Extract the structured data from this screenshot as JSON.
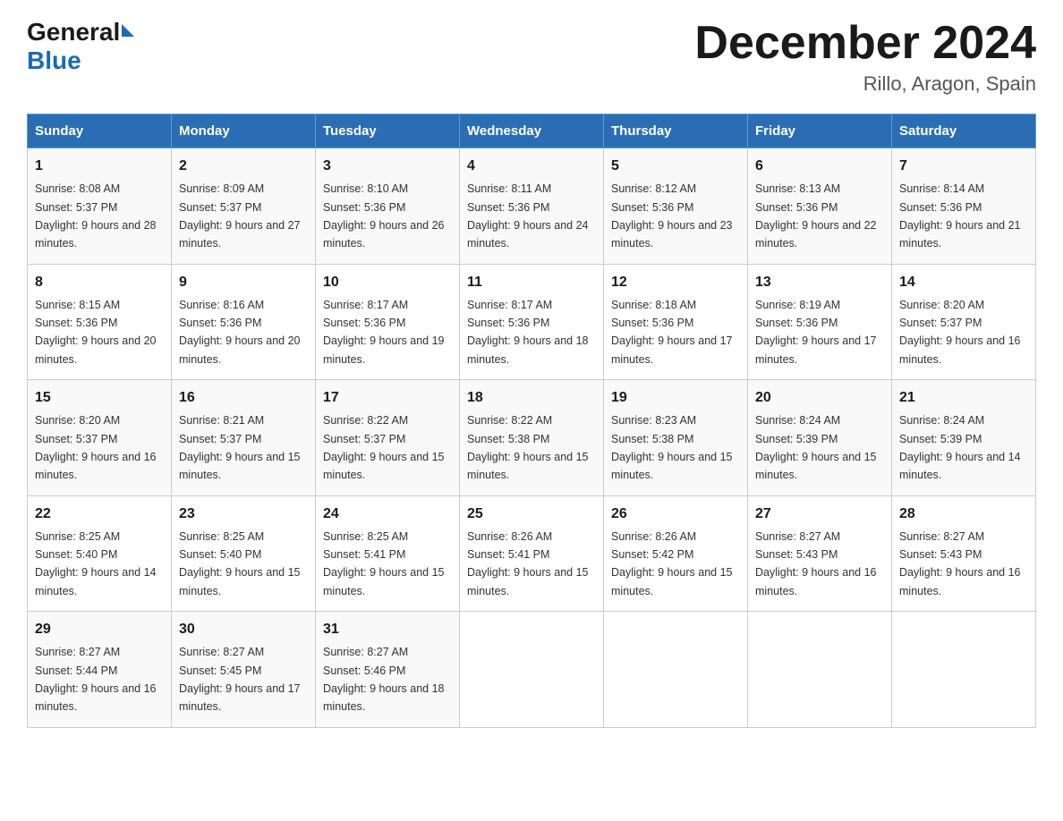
{
  "logo": {
    "general": "General",
    "blue": "Blue"
  },
  "title": "December 2024",
  "location": "Rillo, Aragon, Spain",
  "days_of_week": [
    "Sunday",
    "Monday",
    "Tuesday",
    "Wednesday",
    "Thursday",
    "Friday",
    "Saturday"
  ],
  "weeks": [
    [
      {
        "day": "1",
        "sunrise": "8:08 AM",
        "sunset": "5:37 PM",
        "daylight": "9 hours and 28 minutes."
      },
      {
        "day": "2",
        "sunrise": "8:09 AM",
        "sunset": "5:37 PM",
        "daylight": "9 hours and 27 minutes."
      },
      {
        "day": "3",
        "sunrise": "8:10 AM",
        "sunset": "5:36 PM",
        "daylight": "9 hours and 26 minutes."
      },
      {
        "day": "4",
        "sunrise": "8:11 AM",
        "sunset": "5:36 PM",
        "daylight": "9 hours and 24 minutes."
      },
      {
        "day": "5",
        "sunrise": "8:12 AM",
        "sunset": "5:36 PM",
        "daylight": "9 hours and 23 minutes."
      },
      {
        "day": "6",
        "sunrise": "8:13 AM",
        "sunset": "5:36 PM",
        "daylight": "9 hours and 22 minutes."
      },
      {
        "day": "7",
        "sunrise": "8:14 AM",
        "sunset": "5:36 PM",
        "daylight": "9 hours and 21 minutes."
      }
    ],
    [
      {
        "day": "8",
        "sunrise": "8:15 AM",
        "sunset": "5:36 PM",
        "daylight": "9 hours and 20 minutes."
      },
      {
        "day": "9",
        "sunrise": "8:16 AM",
        "sunset": "5:36 PM",
        "daylight": "9 hours and 20 minutes."
      },
      {
        "day": "10",
        "sunrise": "8:17 AM",
        "sunset": "5:36 PM",
        "daylight": "9 hours and 19 minutes."
      },
      {
        "day": "11",
        "sunrise": "8:17 AM",
        "sunset": "5:36 PM",
        "daylight": "9 hours and 18 minutes."
      },
      {
        "day": "12",
        "sunrise": "8:18 AM",
        "sunset": "5:36 PM",
        "daylight": "9 hours and 17 minutes."
      },
      {
        "day": "13",
        "sunrise": "8:19 AM",
        "sunset": "5:36 PM",
        "daylight": "9 hours and 17 minutes."
      },
      {
        "day": "14",
        "sunrise": "8:20 AM",
        "sunset": "5:37 PM",
        "daylight": "9 hours and 16 minutes."
      }
    ],
    [
      {
        "day": "15",
        "sunrise": "8:20 AM",
        "sunset": "5:37 PM",
        "daylight": "9 hours and 16 minutes."
      },
      {
        "day": "16",
        "sunrise": "8:21 AM",
        "sunset": "5:37 PM",
        "daylight": "9 hours and 15 minutes."
      },
      {
        "day": "17",
        "sunrise": "8:22 AM",
        "sunset": "5:37 PM",
        "daylight": "9 hours and 15 minutes."
      },
      {
        "day": "18",
        "sunrise": "8:22 AM",
        "sunset": "5:38 PM",
        "daylight": "9 hours and 15 minutes."
      },
      {
        "day": "19",
        "sunrise": "8:23 AM",
        "sunset": "5:38 PM",
        "daylight": "9 hours and 15 minutes."
      },
      {
        "day": "20",
        "sunrise": "8:24 AM",
        "sunset": "5:39 PM",
        "daylight": "9 hours and 15 minutes."
      },
      {
        "day": "21",
        "sunrise": "8:24 AM",
        "sunset": "5:39 PM",
        "daylight": "9 hours and 14 minutes."
      }
    ],
    [
      {
        "day": "22",
        "sunrise": "8:25 AM",
        "sunset": "5:40 PM",
        "daylight": "9 hours and 14 minutes."
      },
      {
        "day": "23",
        "sunrise": "8:25 AM",
        "sunset": "5:40 PM",
        "daylight": "9 hours and 15 minutes."
      },
      {
        "day": "24",
        "sunrise": "8:25 AM",
        "sunset": "5:41 PM",
        "daylight": "9 hours and 15 minutes."
      },
      {
        "day": "25",
        "sunrise": "8:26 AM",
        "sunset": "5:41 PM",
        "daylight": "9 hours and 15 minutes."
      },
      {
        "day": "26",
        "sunrise": "8:26 AM",
        "sunset": "5:42 PM",
        "daylight": "9 hours and 15 minutes."
      },
      {
        "day": "27",
        "sunrise": "8:27 AM",
        "sunset": "5:43 PM",
        "daylight": "9 hours and 16 minutes."
      },
      {
        "day": "28",
        "sunrise": "8:27 AM",
        "sunset": "5:43 PM",
        "daylight": "9 hours and 16 minutes."
      }
    ],
    [
      {
        "day": "29",
        "sunrise": "8:27 AM",
        "sunset": "5:44 PM",
        "daylight": "9 hours and 16 minutes."
      },
      {
        "day": "30",
        "sunrise": "8:27 AM",
        "sunset": "5:45 PM",
        "daylight": "9 hours and 17 minutes."
      },
      {
        "day": "31",
        "sunrise": "8:27 AM",
        "sunset": "5:46 PM",
        "daylight": "9 hours and 18 minutes."
      },
      null,
      null,
      null,
      null
    ]
  ]
}
